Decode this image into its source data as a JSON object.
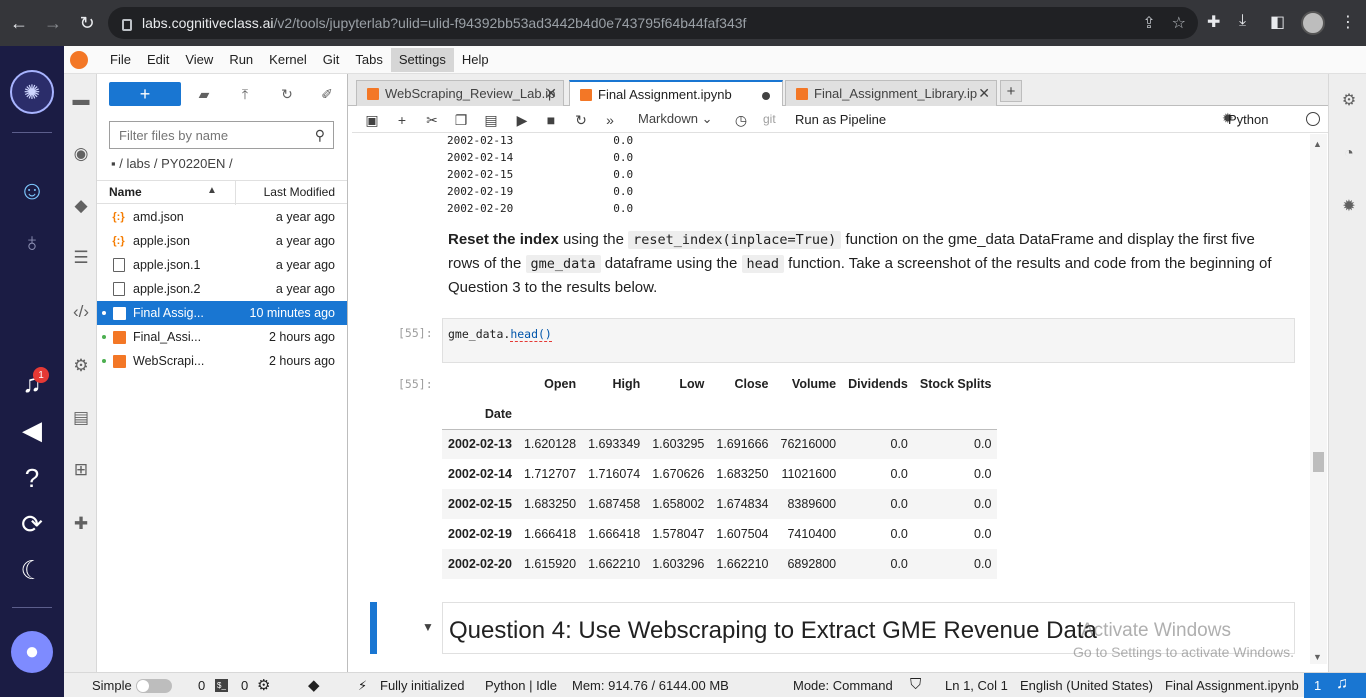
{
  "browser": {
    "url_domain": "labs.cognitiveclass.ai",
    "url_path": "/v2/tools/jupyterlab?ulid=ulid-f94392bb53ad3442b4d0e743795f64b44faf343f"
  },
  "menubar": {
    "items": [
      "File",
      "Edit",
      "View",
      "Run",
      "Kernel",
      "Git",
      "Tabs",
      "Settings",
      "Help"
    ],
    "active": "Settings"
  },
  "filebrowser": {
    "new_label": "+",
    "filter_placeholder": "Filter files by name",
    "breadcrumb": "▪ / labs / PY0220EN /",
    "col_name": "Name",
    "col_modified": "Last Modified",
    "files": [
      {
        "name": "amd.json",
        "modified": "a year ago",
        "type": "json"
      },
      {
        "name": "apple.json",
        "modified": "a year ago",
        "type": "json"
      },
      {
        "name": "apple.json.1",
        "modified": "a year ago",
        "type": "file"
      },
      {
        "name": "apple.json.2",
        "modified": "a year ago",
        "type": "file"
      },
      {
        "name": "Final Assig...",
        "modified": "10 minutes ago",
        "type": "notebook",
        "selected": true,
        "running": true
      },
      {
        "name": "Final_Assi...",
        "modified": "2 hours ago",
        "type": "notebook",
        "running": true
      },
      {
        "name": "WebScrapi...",
        "modified": "2 hours ago",
        "type": "notebook",
        "running": true
      }
    ]
  },
  "tabs": [
    {
      "label": "WebScraping_Review_Lab.ip",
      "current": false
    },
    {
      "label": "Final Assignment.ipynb",
      "current": true,
      "dirty": true
    },
    {
      "label": "Final_Assignment_Library.ip",
      "current": false
    }
  ],
  "nbtoolbar": {
    "cell_type": "Markdown",
    "git": "git",
    "pipeline": "Run as Pipeline",
    "kernel": "Python"
  },
  "notebook": {
    "prev_output": [
      {
        "date": "2002-02-13",
        "value": "0.0"
      },
      {
        "date": "2002-02-14",
        "value": "0.0"
      },
      {
        "date": "2002-02-15",
        "value": "0.0"
      },
      {
        "date": "2002-02-19",
        "value": "0.0"
      },
      {
        "date": "2002-02-20",
        "value": "0.0"
      }
    ],
    "md": {
      "bold": "Reset the index",
      "t1": " using the ",
      "c1": "reset_index(inplace=True)",
      "t2": " function on the gme_data DataFrame and display the first five rows of the ",
      "c2": "gme_data",
      "t3": " dataframe using the ",
      "c3": "head",
      "t4": " function. Take a screenshot of the results and code from the beginning of Question 3 to the results below."
    },
    "in_prompt": "[55]:",
    "out_prompt": "[55]:",
    "code_obj": "gme_data.",
    "code_method": "head()",
    "table": {
      "columns": [
        "Open",
        "High",
        "Low",
        "Close",
        "Volume",
        "Dividends",
        "Stock Splits"
      ],
      "index_name": "Date",
      "rows": [
        {
          "idx": "2002-02-13",
          "vals": [
            "1.620128",
            "1.693349",
            "1.603295",
            "1.691666",
            "76216000",
            "0.0",
            "0.0"
          ]
        },
        {
          "idx": "2002-02-14",
          "vals": [
            "1.712707",
            "1.716074",
            "1.670626",
            "1.683250",
            "11021600",
            "0.0",
            "0.0"
          ]
        },
        {
          "idx": "2002-02-15",
          "vals": [
            "1.683250",
            "1.687458",
            "1.658002",
            "1.674834",
            "8389600",
            "0.0",
            "0.0"
          ]
        },
        {
          "idx": "2002-02-19",
          "vals": [
            "1.666418",
            "1.666418",
            "1.578047",
            "1.607504",
            "7410400",
            "0.0",
            "0.0"
          ]
        },
        {
          "idx": "2002-02-20",
          "vals": [
            "1.615920",
            "1.662210",
            "1.603296",
            "1.662210",
            "6892800",
            "0.0",
            "0.0"
          ]
        }
      ]
    },
    "heading": "Question 4: Use Webscraping to Extract GME Revenue Data"
  },
  "watermark": {
    "line1": "Activate Windows",
    "line2": "Go to Settings to activate Windows."
  },
  "sidebar": {
    "notification_count": "1"
  },
  "statusbar": {
    "mode_label": "Simple",
    "terminals": "0",
    "kernels": "0",
    "init": "Fully initialized",
    "kernel_status": "Python | Idle",
    "mem": "Mem: 914.76 / 6144.00 MB",
    "mode": "Mode: Command",
    "position": "Ln 1, Col 1",
    "language": "English (United States)",
    "filename": "Final Assignment.ipynb",
    "notif_count": "1"
  }
}
